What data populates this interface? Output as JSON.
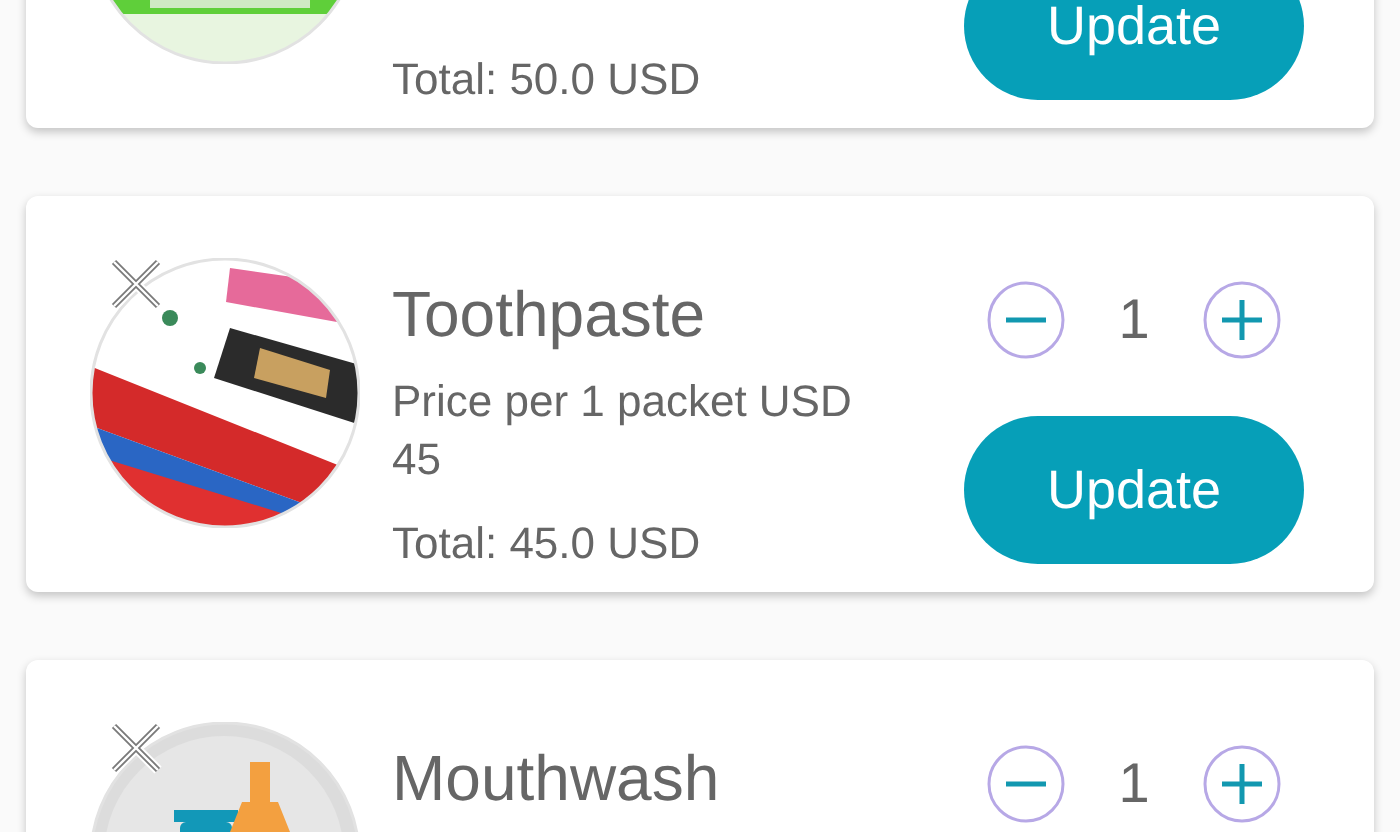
{
  "cart_items": [
    {
      "total": "Total: 50.0 USD",
      "update_button": "Update"
    },
    {
      "name": "Toothpaste",
      "price": "Price per 1 packet USD 45",
      "quantity": "1",
      "total": "Total: 45.0 USD",
      "update_button": "Update"
    },
    {
      "name": "Mouthwash",
      "quantity": "1"
    }
  ]
}
